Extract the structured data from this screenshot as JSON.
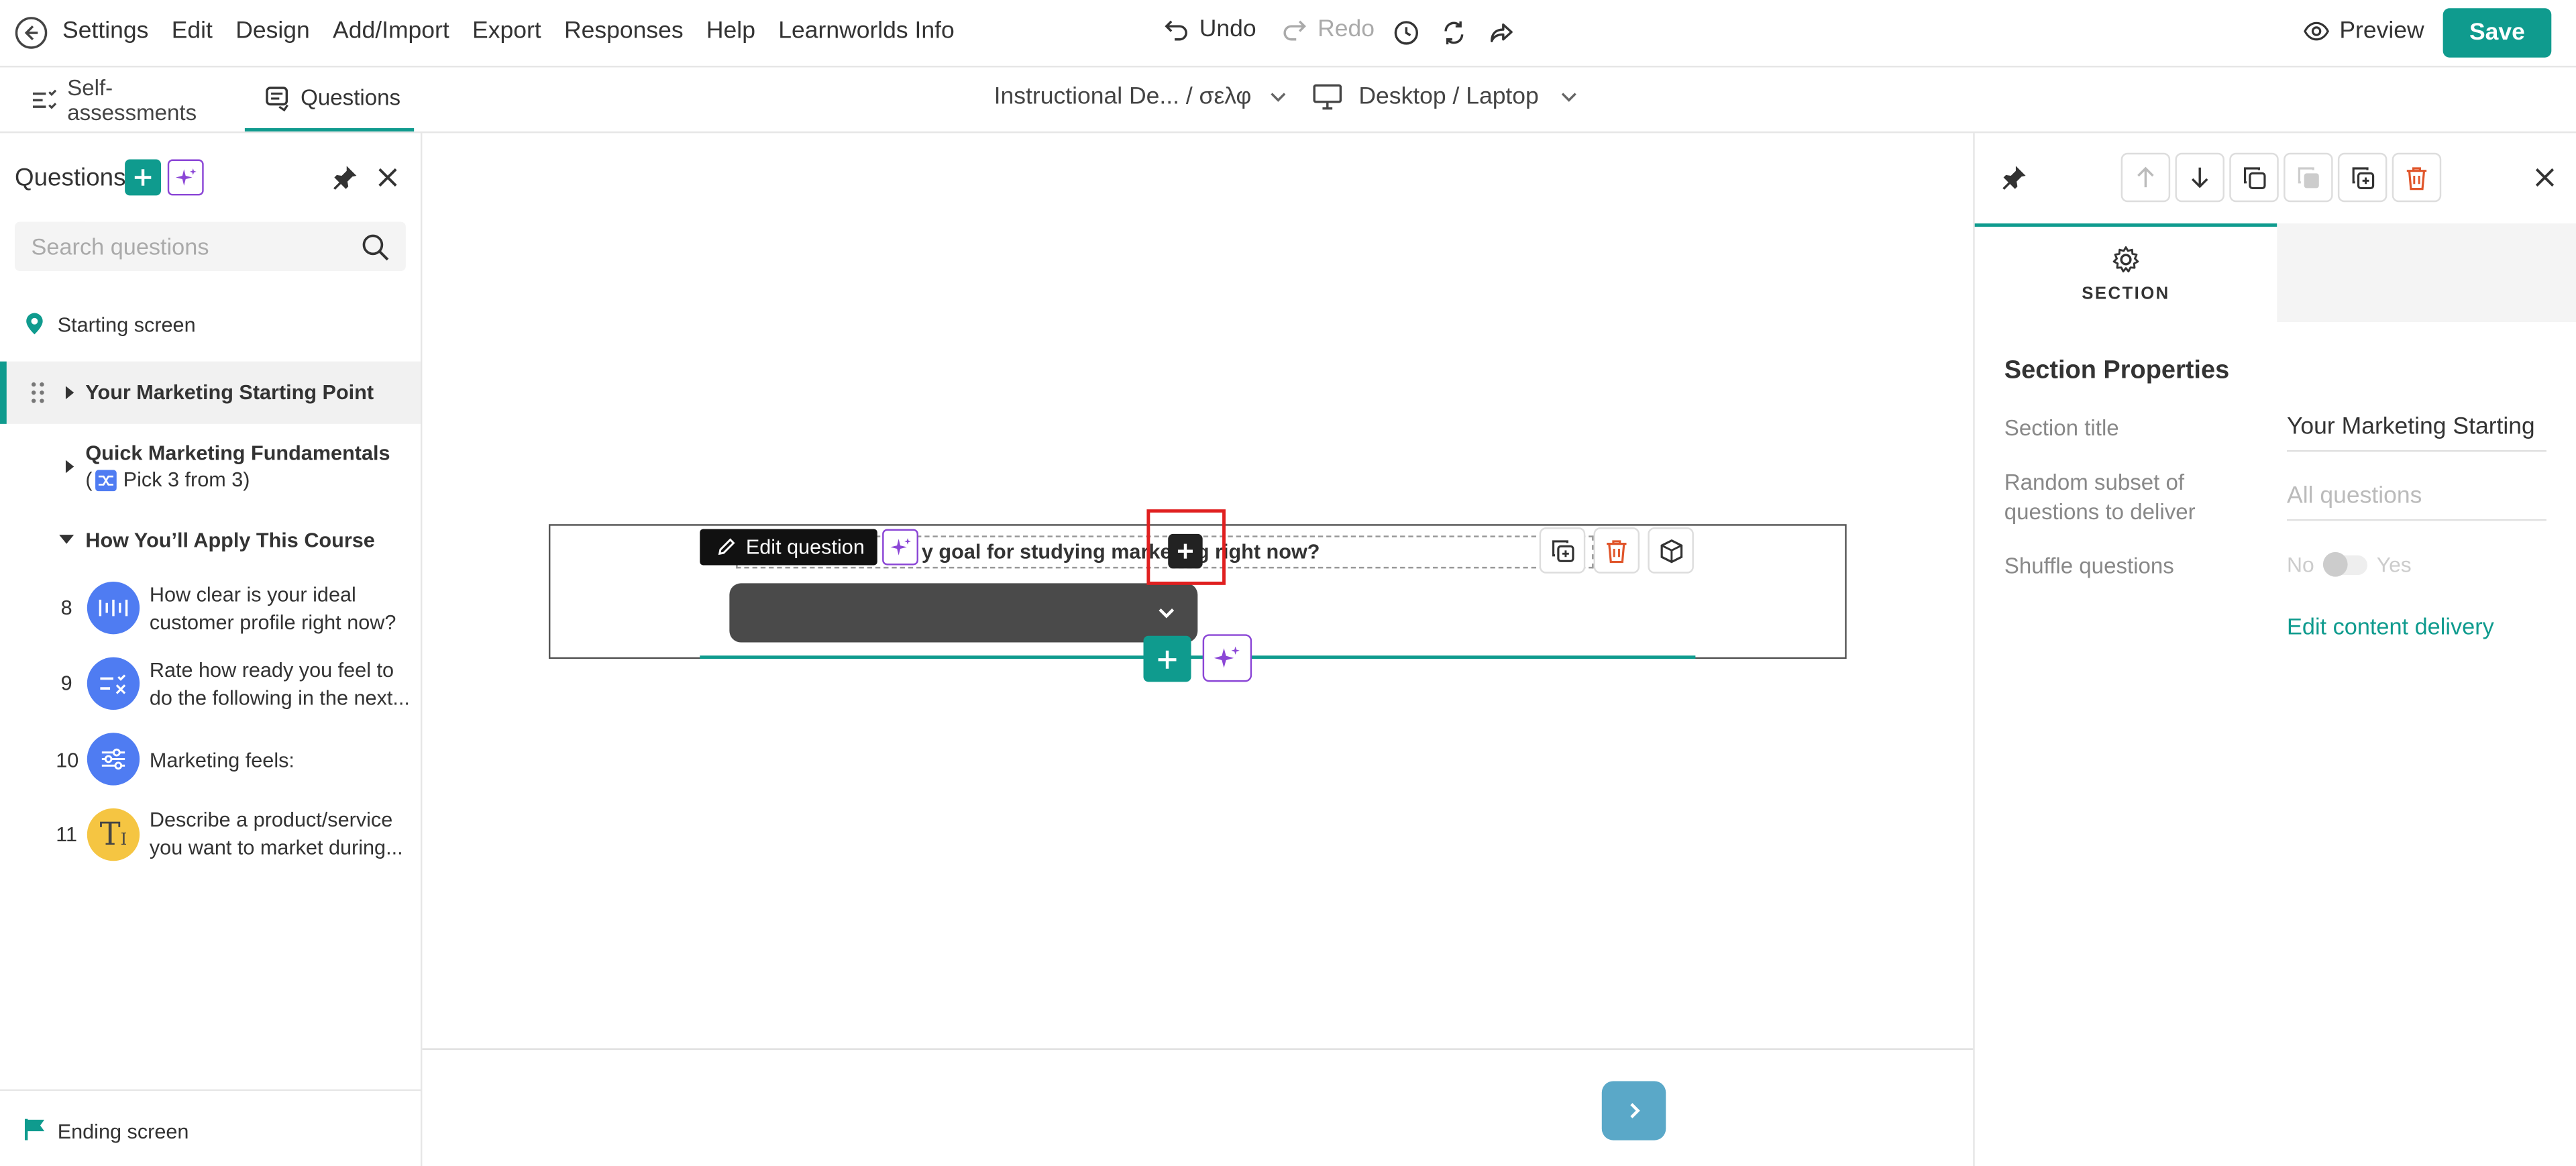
{
  "topbar": {
    "menu": [
      "Settings",
      "Edit",
      "Design",
      "Add/Import",
      "Export",
      "Responses",
      "Help",
      "Learnworlds Info"
    ],
    "undo_label": "Undo",
    "redo_label": "Redo",
    "preview_label": "Preview",
    "save_label": "Save"
  },
  "subbar": {
    "tabs": [
      "Self-assessments",
      "Questions"
    ],
    "active_tab": "Questions",
    "language_select": "Instructional De...  / σελφ",
    "device_select": "Desktop / Laptop"
  },
  "left_panel": {
    "title": "Questions",
    "search_placeholder": "Search questions",
    "starting_screen": "Starting screen",
    "sections": [
      {
        "title": "Your Marketing Starting Point"
      },
      {
        "title": "Quick Marketing Fundamentals",
        "subtitle_prefix": "(",
        "subtitle": "Pick 3 from 3)"
      },
      {
        "title": "How You’ll Apply This Course"
      }
    ],
    "questions": [
      {
        "num": "8",
        "text": "How clear is your ideal customer profile right now?",
        "icon": "scale-icon",
        "color": "#4f7cf2"
      },
      {
        "num": "9",
        "text": "Rate how ready you feel to do the following in the next...",
        "icon": "rating-list-icon",
        "color": "#4f7cf2"
      },
      {
        "num": "10",
        "text": "Marketing feels:",
        "icon": "sliders-icon",
        "color": "#4f7cf2"
      },
      {
        "num": "11",
        "text": "Describe a product/service you want to market during...",
        "icon": "text-icon",
        "color": "#f5c542"
      }
    ],
    "ending_screen": "Ending screen"
  },
  "canvas": {
    "edit_question_label": "Edit question",
    "question_title": "y goal for studying marketing right now?"
  },
  "right_panel": {
    "tab_label": "SECTION",
    "heading": "Section Properties",
    "section_title_label": "Section title",
    "section_title_value": "Your Marketing Starting Point",
    "random_subset_label": "Random subset of questions to deliver",
    "random_subset_placeholder": "All questions",
    "shuffle_label": "Shuffle questions",
    "shuffle_no": "No",
    "shuffle_yes": "Yes",
    "edit_delivery_link": "Edit content delivery"
  },
  "colors": {
    "accent": "#0f9b8e",
    "ai_purple": "#8b46d6",
    "delete_red": "#e0552a",
    "question_blue": "#4f7cf2",
    "question_yellow": "#f5c542",
    "highlight_red": "#e02020"
  }
}
